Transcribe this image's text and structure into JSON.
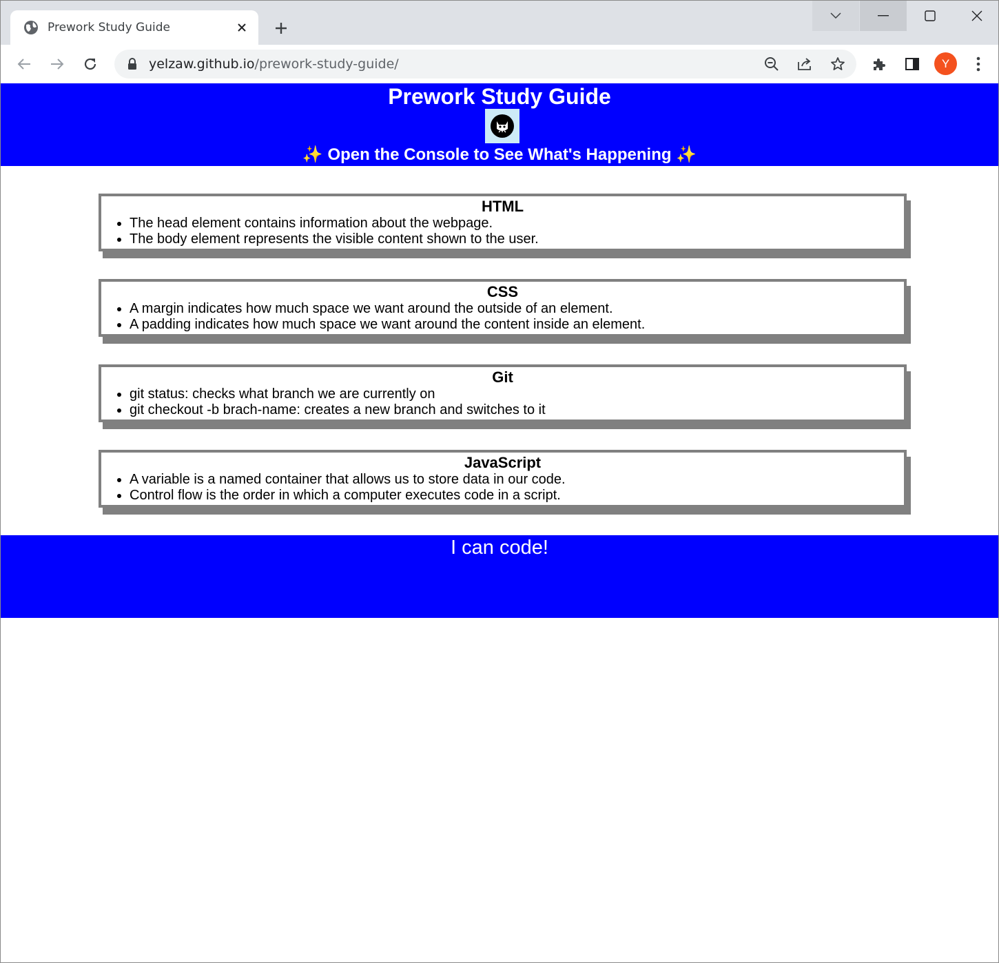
{
  "browser": {
    "tab_title": "Prework Study Guide",
    "url_host": "yelzaw.github.io",
    "url_path": "/prework-study-guide/",
    "profile_initial": "Y",
    "profile_color": "#f4511e"
  },
  "page": {
    "title": "Prework Study Guide",
    "subtitle_emoji_left": "✨",
    "subtitle": "Open the Console to See What's Happening",
    "subtitle_emoji_right": "✨",
    "header_color": "#0000ff",
    "sections": [
      {
        "heading": "HTML",
        "items": [
          "The head element contains information about the webpage.",
          "The body element represents the visible content shown to the user."
        ]
      },
      {
        "heading": "CSS",
        "items": [
          "A margin indicates how much space we want around the outside of an element.",
          "A padding indicates how much space we want around the content inside an element."
        ]
      },
      {
        "heading": "Git",
        "items": [
          "git status: checks what branch we are currently on",
          "git checkout -b brach-name: creates a new branch and switches to it"
        ]
      },
      {
        "heading": "JavaScript",
        "items": [
          "A variable is a named container that allows us to store data in our code.",
          "Control flow is the order in which a computer executes code in a script."
        ]
      }
    ],
    "footer_text": "I can code!"
  }
}
